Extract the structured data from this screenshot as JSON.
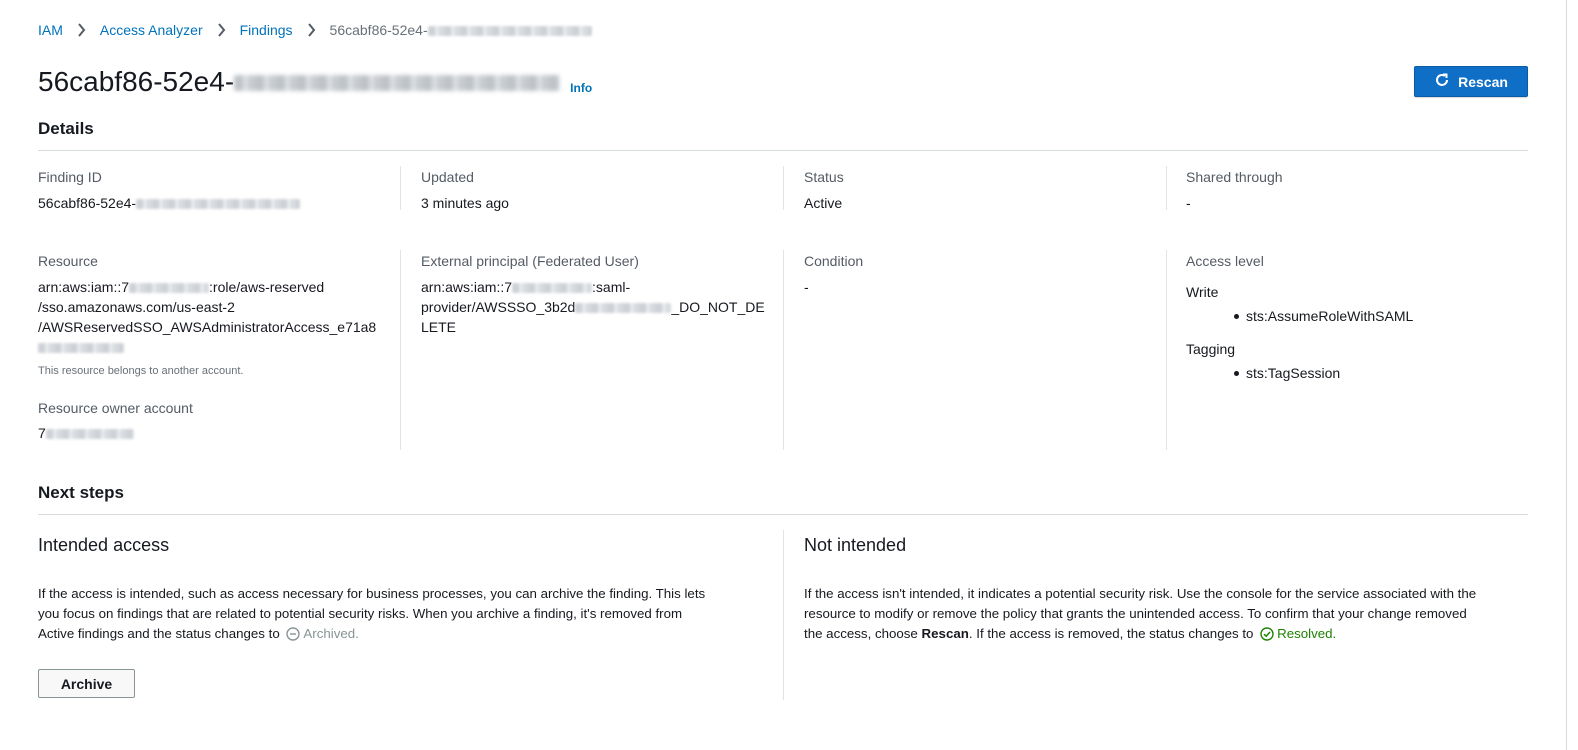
{
  "breadcrumb": {
    "items": [
      "IAM",
      "Access Analyzer",
      "Findings"
    ],
    "current": "56cabf86-52e4-"
  },
  "header": {
    "title": "56cabf86-52e4-",
    "info": "Info",
    "rescan_label": "Rescan"
  },
  "details": {
    "title": "Details",
    "finding_id": {
      "label": "Finding ID",
      "value": "56cabf86-52e4-"
    },
    "updated": {
      "label": "Updated",
      "value": "3 minutes ago"
    },
    "status": {
      "label": "Status",
      "value": "Active"
    },
    "shared_through": {
      "label": "Shared through",
      "value": "-"
    },
    "resource": {
      "label": "Resource",
      "line1_a": "arn:aws:iam::7",
      "line1_b": ":role/aws-reserved",
      "line2": "/sso.amazonaws.com/us-east-2",
      "line3": "/AWSReservedSSO_AWSAdministratorAccess_e71a8",
      "note": "This resource belongs to another account."
    },
    "resource_owner": {
      "label": "Resource owner account",
      "value": "7"
    },
    "external_principal": {
      "label": "External principal (Federated User)",
      "line1_a": "arn:aws:iam::7",
      "line1_b": ":saml-",
      "line2_a": "provider/AWSSSO_3b2d",
      "line2_b": "_DO_NOT_DE",
      "line3": "LETE"
    },
    "condition": {
      "label": "Condition",
      "value": "-"
    },
    "access_level": {
      "label": "Access level",
      "groups": [
        {
          "name": "Write",
          "items": [
            "sts:AssumeRoleWithSAML"
          ]
        },
        {
          "name": "Tagging",
          "items": [
            "sts:TagSession"
          ]
        }
      ]
    }
  },
  "next_steps": {
    "title": "Next steps",
    "intended": {
      "title": "Intended access",
      "p1": "If the access is intended, such as access necessary for business processes, you can archive the finding. This lets",
      "p2": "you focus on findings that are related to potential security risks. When you archive a finding, it's removed from",
      "p3": "Active findings and the status changes to",
      "archived_label": "Archived.",
      "archive_button": "Archive"
    },
    "not_intended": {
      "title": "Not intended",
      "p1": "If the access isn't intended, it indicates a potential security risk. Use the console for the service associated with the",
      "p2": "resource to modify or remove the policy that grants the unintended access. To confirm that your change removed",
      "p3_a": "the access, choose",
      "p3_bold": "Rescan",
      "p3_b": ". If the access is removed, the status changes to",
      "resolved_label": "Resolved."
    }
  },
  "colors": {
    "link": "#0073bb",
    "primary": "#0f6fc6",
    "resolved": "#1d8102",
    "archived": "#879596"
  }
}
